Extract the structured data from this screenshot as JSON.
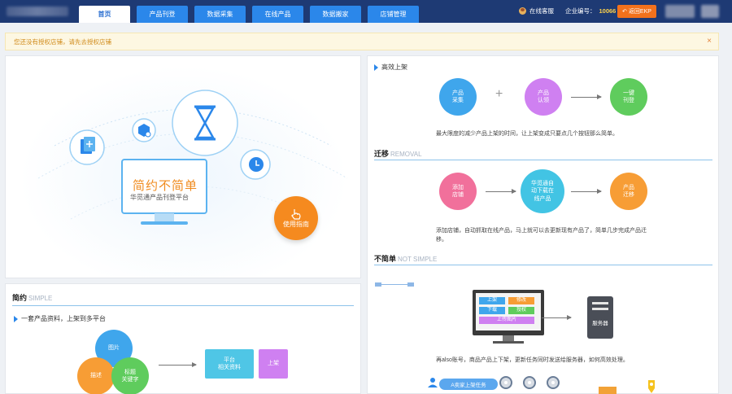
{
  "nav": {
    "tabs": [
      "首页",
      "产品刊登",
      "数据采集",
      "在线产品",
      "数据搬家",
      "店铺管理"
    ],
    "active": 0
  },
  "header": {
    "user_label": "在线客服",
    "company_label": "企业编号：",
    "company_number": "10066",
    "back_label": "返回EKP"
  },
  "notice": {
    "text": "您还没有授权店铺，请先去授权店铺",
    "close": "×"
  },
  "hero": {
    "title": "简约不简单",
    "subtitle": "华觅通产品刊登平台",
    "guide_button": "使用指南"
  },
  "simple": {
    "title": "简约",
    "title_en": "SIMPLE",
    "bullet": "一套产品资料，上架到多平台",
    "circles": [
      "图片",
      "描述",
      "标题\n关键字"
    ],
    "platform_box": "平台\n相关资料",
    "listing_box": "上架"
  },
  "right": {
    "efficient": {
      "title": "高效上架",
      "steps": [
        "产品\n采集",
        "产品\n认领",
        "一键\n刊登"
      ],
      "plus": "+",
      "desc": "最大限度的减少产品上架的时间，让上架变成只要点几个按钮那么简单。"
    },
    "removal": {
      "title": "迁移",
      "title_en": "REMOVAL",
      "steps": [
        "添加\n店铺",
        "华觅通自\n动下载在\n线产品",
        "产品\n迁移"
      ],
      "desc": "添加店铺，自动抓取在线产品，马上就可以去更新现有产品了，简单几步完成产品迁移。"
    },
    "notsimple": {
      "title": "不简单",
      "title_en": "NOT SIMPLE",
      "monitor_buttons": [
        "上架",
        "修改",
        "下载",
        "授权",
        "上传图片"
      ],
      "server_label": "服务器",
      "desc": "再also账号，商品产品上下架，更新任务同时发送给服务器，如何高效处理。",
      "pill": "A卖家上架任务"
    }
  }
}
